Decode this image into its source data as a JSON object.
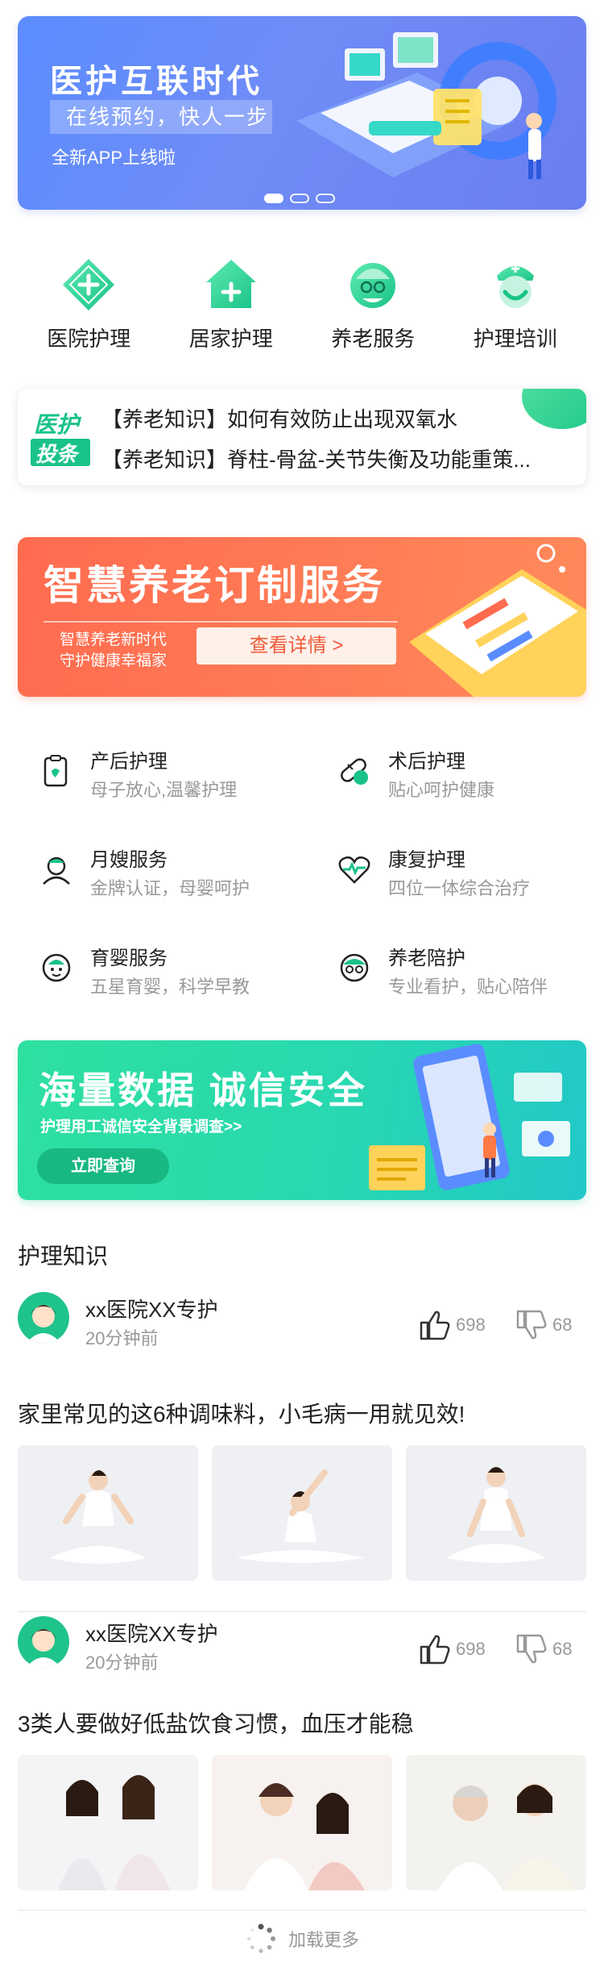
{
  "hero": {
    "title": "医护互联时代",
    "subtitle": "在线预约，快人一步",
    "tagline": "全新APP上线啦",
    "colors": {
      "bg": "#5b8cff",
      "accent": "#36d8c8"
    }
  },
  "quick_nav": [
    {
      "label": "医院护理",
      "icon": "plus-diamond-icon"
    },
    {
      "label": "居家护理",
      "icon": "home-plus-icon"
    },
    {
      "label": "养老服务",
      "icon": "elder-face-icon"
    },
    {
      "label": "护理培训",
      "icon": "nurse-icon"
    }
  ],
  "news": {
    "badge_line1": "医护",
    "badge_line2": "投条",
    "items": [
      "【养老知识】如何有效防止出现双氧水",
      "【养老知识】脊柱-骨盆-关节失衡及功能重策..."
    ]
  },
  "promo_orange": {
    "title": "智慧养老订制服务",
    "sub1": "智慧养老新时代",
    "sub2": "守护健康幸福家",
    "button": "查看详情 >"
  },
  "services": [
    {
      "title": "产后护理",
      "desc": "母子放心,温馨护理",
      "icon": "postpartum-icon"
    },
    {
      "title": "术后护理",
      "desc": "贴心呵护健康",
      "icon": "surgery-icon"
    },
    {
      "title": "月嫂服务",
      "desc": "金牌认证，母婴呵护",
      "icon": "nanny-icon"
    },
    {
      "title": "康复护理",
      "desc": "四位一体综合治疗",
      "icon": "heartbeat-icon"
    },
    {
      "title": "育婴服务",
      "desc": "五星育婴，科学早教",
      "icon": "baby-icon"
    },
    {
      "title": "养老陪护",
      "desc": "专业看护，贴心陪伴",
      "icon": "elder-icon"
    }
  ],
  "promo_green": {
    "title": "海量数据 诚信安全",
    "subtitle": "护理用工诚信安全背景调查>>",
    "button": "立即查询"
  },
  "knowledge": {
    "title": "护理知识",
    "posts": [
      {
        "author": "xx医院XX专护",
        "time": "20分钟前",
        "likes": "698",
        "dislikes": "68",
        "text": "家里常见的这6种调味料，小毛病一用就见效!"
      },
      {
        "author": "xx医院XX专护",
        "time": "20分钟前",
        "likes": "698",
        "dislikes": "68",
        "text": "3类人要做好低盐饮食习惯，血压才能稳"
      }
    ]
  },
  "load_more": "加载更多"
}
